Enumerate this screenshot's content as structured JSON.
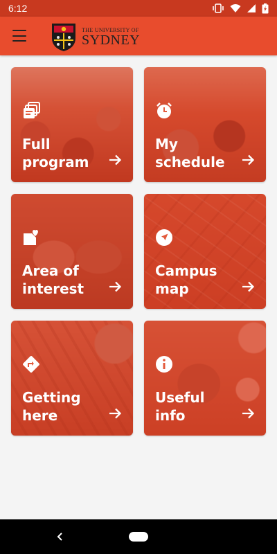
{
  "status_bar": {
    "time": "6:12"
  },
  "header": {
    "logo_top": "THE UNIVERSITY OF",
    "logo_main": "SYDNEY"
  },
  "tiles": [
    {
      "label": "Full\nprogram",
      "icon": "program-icon"
    },
    {
      "label": "My\nschedule",
      "icon": "alarm-clock-icon"
    },
    {
      "label": "Area of\ninterest",
      "icon": "heart-tag-icon"
    },
    {
      "label": "Campus\nmap",
      "icon": "navigation-icon"
    },
    {
      "label": "Getting\nhere",
      "icon": "directions-icon"
    },
    {
      "label": "Useful\ninfo",
      "icon": "info-icon"
    }
  ],
  "colors": {
    "accent": "#e84c2d",
    "status_bar": "#c8391f",
    "tile_tint": "#d63e21"
  }
}
